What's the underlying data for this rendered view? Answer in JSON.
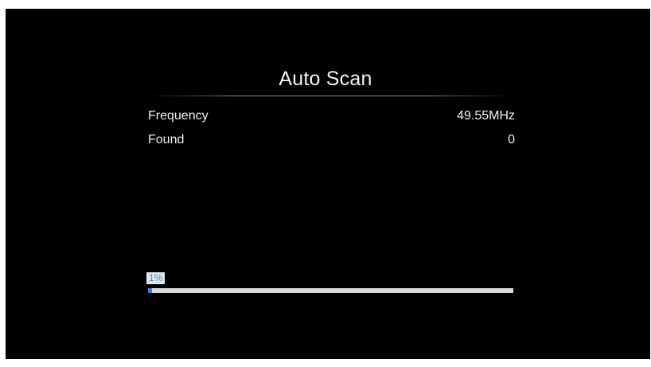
{
  "dialog": {
    "title": "Auto Scan"
  },
  "rows": [
    {
      "label": "Frequency",
      "value": "49.55MHz"
    },
    {
      "label": "Found",
      "value": "0"
    }
  ],
  "progress": {
    "label": "1%",
    "percent": 1
  },
  "colors": {
    "background": "#000000",
    "text": "#f0f0f0",
    "progress_track": "#d9d9d9",
    "progress_fill": "#3a7fd0",
    "badge_background": "#dce6ee",
    "badge_text": "#5a8fbf"
  }
}
